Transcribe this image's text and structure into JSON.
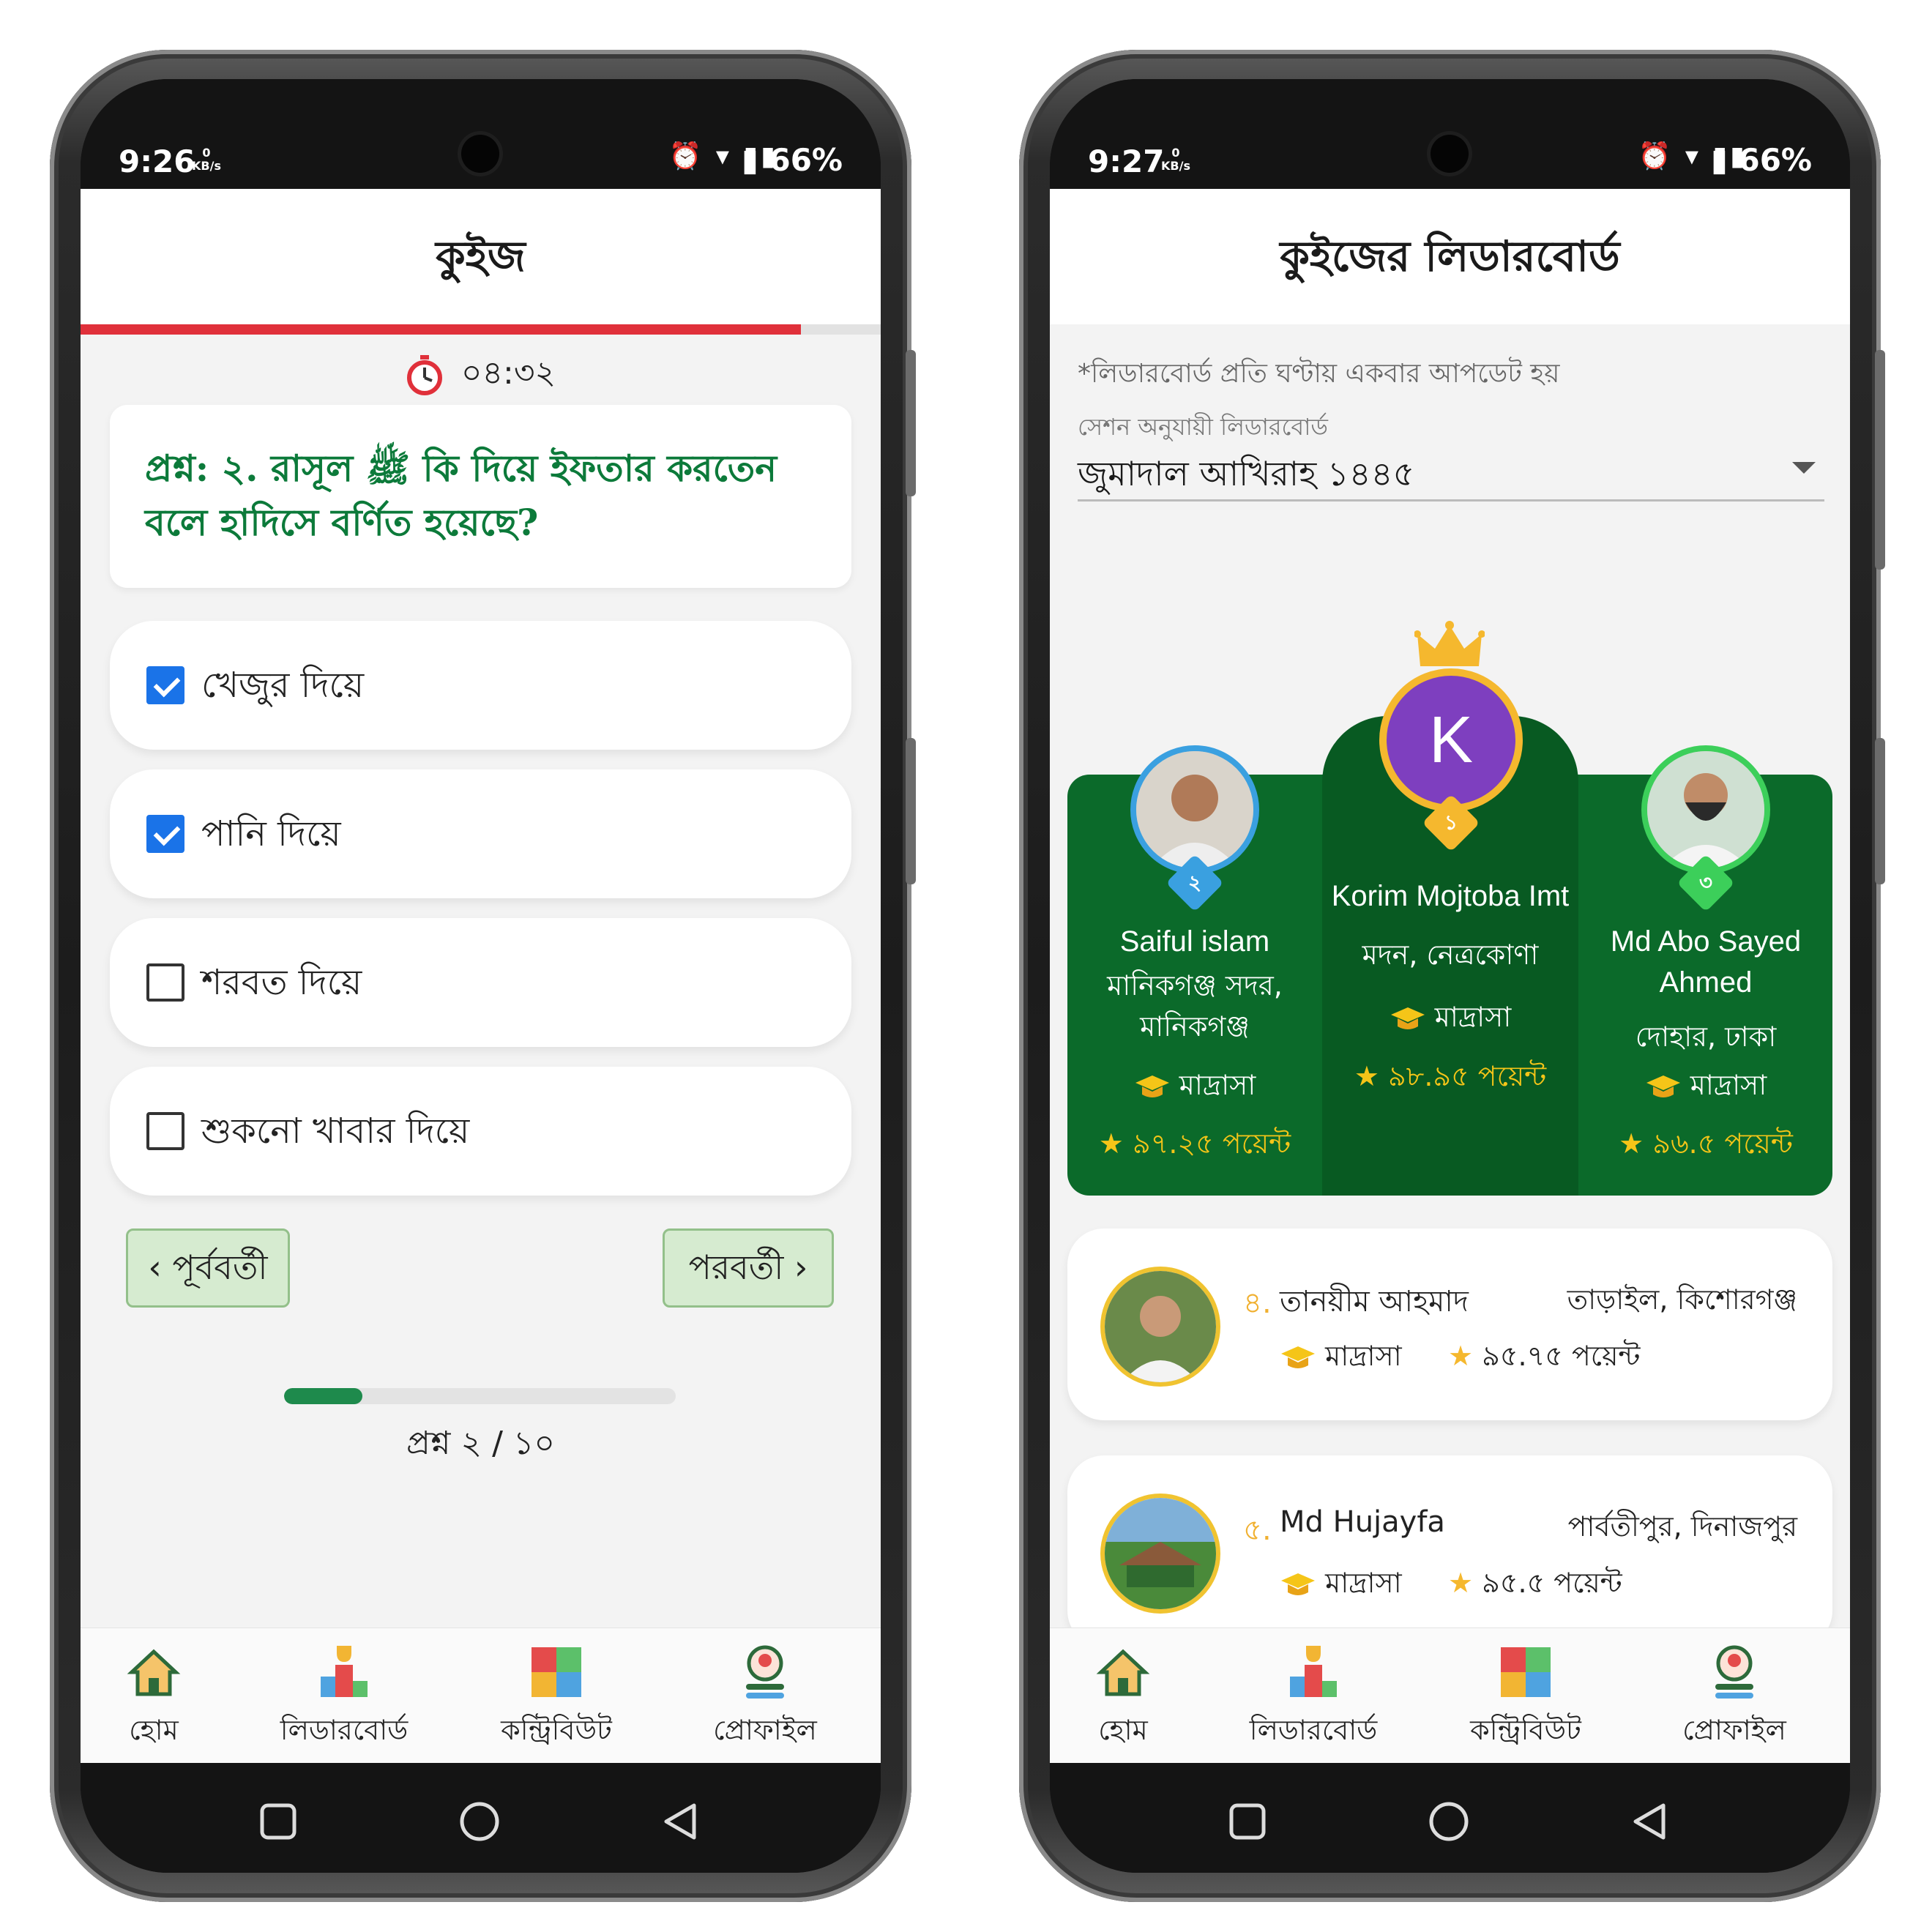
{
  "quiz_screen": {
    "status": {
      "time": "9:26",
      "speed_value": "0",
      "speed_unit": "KB/s",
      "battery": "66%"
    },
    "title": "কুইজ",
    "timer": "০৪:৩২",
    "timer_progress": 0.9,
    "question": "প্রশ্ন: ২. রাসূল ﷺ কি দিয়ে ইফতার করতেন বলে হাদিসে বর্ণিত হয়েছে?",
    "options": [
      {
        "label": "খেজুর দিয়ে",
        "checked": true
      },
      {
        "label": "পানি দিয়ে",
        "checked": true
      },
      {
        "label": "শরবত দিয়ে",
        "checked": false
      },
      {
        "label": "শুকনো খাবার দিয়ে",
        "checked": false
      }
    ],
    "prev_label": "পূর্ববর্তী",
    "next_label": "পরবর্তী",
    "question_progress": 0.2,
    "question_count": "প্রশ্ন ২ / ১০"
  },
  "leaderboard_screen": {
    "status": {
      "time": "9:27",
      "speed_value": "0",
      "speed_unit": "KB/s",
      "battery": "66%"
    },
    "title": "কুইজের লিডারবোর্ড",
    "note": "*লিডারবোর্ড প্রতি ঘণ্টায় একবার আপডেট হয়",
    "session_label": "সেশন অনুযায়ী লিডারবোর্ড",
    "session_value": "জুমাদাল আখিরাহ ১৪৪৫",
    "podium": [
      {
        "rank": "২",
        "name": "Saiful islam",
        "location": "মানিকগঞ্জ সদর, মানিকগঞ্জ",
        "institution": "মাদ্রাসা",
        "points": "৯৭.২৫ পয়েন্ট"
      },
      {
        "rank": "১",
        "initial": "K",
        "name": "Korim Mojtoba Imt",
        "location": "মদন, নেত্রকোণা",
        "institution": "মাদ্রাসা",
        "points": "৯৮.৯৫ পয়েন্ট"
      },
      {
        "rank": "৩",
        "name": "Md Abo Sayed Ahmed",
        "location": "দোহার, ঢাকা",
        "institution": "মাদ্রাসা",
        "points": "৯৬.৫ পয়েন্ট"
      }
    ],
    "list": [
      {
        "rank": "৪.",
        "name": "তানয়ীম আহমাদ",
        "location": "তাড়াইল, কিশোরগঞ্জ",
        "institution": "মাদ্রাসা",
        "points": "৯৫.৭৫ পয়েন্ট"
      },
      {
        "rank": "৫.",
        "name": "Md Hujayfa",
        "location": "পার্বতীপুর, দিনাজপুর",
        "institution": "মাদ্রাসা",
        "points": "৯৫.৫ পয়েন্ট"
      }
    ]
  },
  "bottom_nav": {
    "home": "হোম",
    "leaderboard": "লিডারবোর্ড",
    "contribute": "কন্ট্রিবিউট",
    "profile": "প্রোফাইল"
  },
  "colors": {
    "accent_green": "#0c7a3a",
    "podium_green": "#0b6a2a",
    "timer_red": "#e0303a",
    "checkbox_blue": "#1a73e8",
    "gold": "#f5c518",
    "avatar_purple": "#7e3fbf"
  }
}
